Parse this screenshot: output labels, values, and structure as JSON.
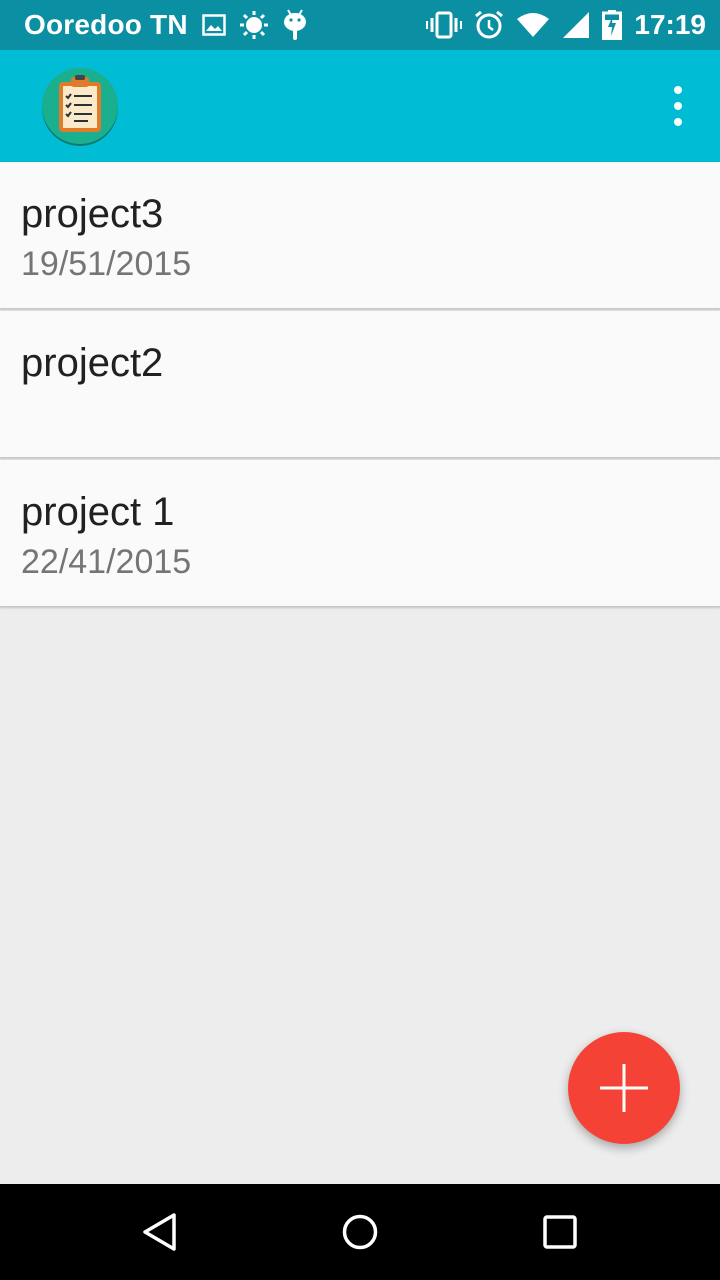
{
  "status_bar": {
    "carrier": "Ooredoo TN",
    "time": "17:19",
    "left_icons": [
      "image-icon",
      "brightness-icon",
      "android-icon"
    ],
    "right_icons": [
      "vibrate-icon",
      "alarm-icon",
      "wifi-icon",
      "signal-icon",
      "battery-charging-icon"
    ]
  },
  "app_bar": {
    "logo_icon": "clipboard-checklist-icon",
    "menu_icon": "overflow-menu-icon",
    "background": "#00bcd4"
  },
  "projects": [
    {
      "name": "project3",
      "date": "19/51/2015"
    },
    {
      "name": "project2",
      "date": ""
    },
    {
      "name": "project 1",
      "date": "22/41/2015"
    }
  ],
  "fab": {
    "icon": "plus-icon",
    "color": "#f44336"
  },
  "nav_bar": {
    "icons": [
      "back-icon",
      "home-icon",
      "recents-icon"
    ]
  }
}
